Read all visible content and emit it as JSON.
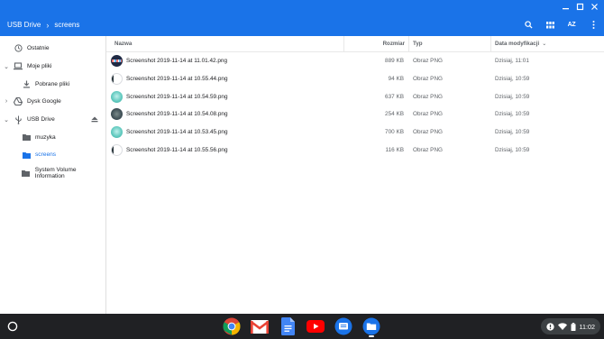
{
  "window": {
    "frame_buttons": [
      "minimize",
      "maximize",
      "close"
    ]
  },
  "toolbar": {
    "breadcrumb": [
      "USB Drive",
      "screens"
    ],
    "separator": "›",
    "sort_label": "AZ"
  },
  "sidebar": {
    "items": [
      {
        "label": "Ostatnie",
        "icon": "clock-icon"
      },
      {
        "label": "Moje pliki",
        "icon": "laptop-icon"
      },
      {
        "label": "Pobrane pliki",
        "icon": "download-icon"
      },
      {
        "label": "Dysk Google",
        "icon": "drive-icon"
      },
      {
        "label": "USB Drive",
        "icon": "usb-icon"
      },
      {
        "label": "muzyka",
        "icon": "folder-icon"
      },
      {
        "label": "screens",
        "icon": "folder-icon"
      },
      {
        "label": "System Volume Information",
        "icon": "folder-icon"
      }
    ]
  },
  "list": {
    "columns": {
      "name": "Nazwa",
      "size": "Rozmiar",
      "type": "Typ",
      "date": "Data modyfikacji"
    },
    "sort_indicator": "⌄",
    "rows": [
      {
        "name": "Screenshot 2019-11-14 at 11.01.42.png",
        "size": "889 KB",
        "type": "Obraz PNG",
        "date": "Dzisiaj, 11:01"
      },
      {
        "name": "Screenshot 2019-11-14 at 10.55.44.png",
        "size": "94 KB",
        "type": "Obraz PNG",
        "date": "Dzisiaj, 10:59"
      },
      {
        "name": "Screenshot 2019-11-14 at 10.54.59.png",
        "size": "637 KB",
        "type": "Obraz PNG",
        "date": "Dzisiaj, 10:59"
      },
      {
        "name": "Screenshot 2019-11-14 at 10.54.08.png",
        "size": "254 KB",
        "type": "Obraz PNG",
        "date": "Dzisiaj, 10:59"
      },
      {
        "name": "Screenshot 2019-11-14 at 10.53.45.png",
        "size": "700 KB",
        "type": "Obraz PNG",
        "date": "Dzisiaj, 10:59"
      },
      {
        "name": "Screenshot 2019-11-14 at 10.55.56.png",
        "size": "116 KB",
        "type": "Obraz PNG",
        "date": "Dzisiaj, 10:59"
      }
    ]
  },
  "shelf": {
    "apps": [
      "chrome-icon",
      "gmail-icon",
      "docs-icon",
      "youtube-icon",
      "messages-icon",
      "files-icon"
    ],
    "tray_time": "11:02"
  },
  "colors": {
    "accent": "#1a73e8",
    "shelf": "#202124"
  }
}
